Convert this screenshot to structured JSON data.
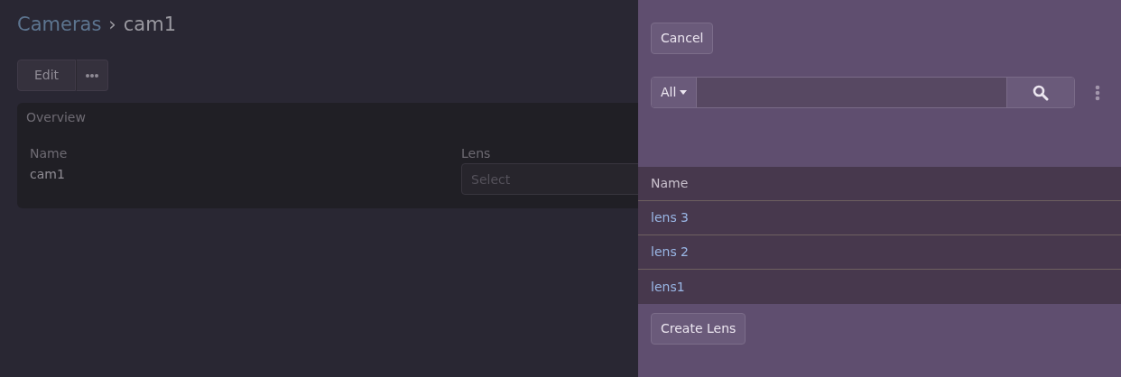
{
  "breadcrumb": {
    "parent": "Cameras",
    "separator": "›",
    "current": "cam1"
  },
  "toolbar": {
    "edit_button": "Edit"
  },
  "overview": {
    "title": "Overview",
    "fields": [
      {
        "kind": "text",
        "label": "Name",
        "value": "cam1"
      },
      {
        "kind": "select",
        "label": "Lens",
        "placeholder": "Select"
      }
    ]
  },
  "panel": {
    "cancel_button": "Cancel",
    "search": {
      "filter": "All"
    },
    "table": {
      "columns": [
        "Name"
      ],
      "rows": [
        {
          "name": "lens 3"
        },
        {
          "name": "lens 2"
        },
        {
          "name": "lens1"
        }
      ]
    },
    "create_button": "Create Lens"
  }
}
